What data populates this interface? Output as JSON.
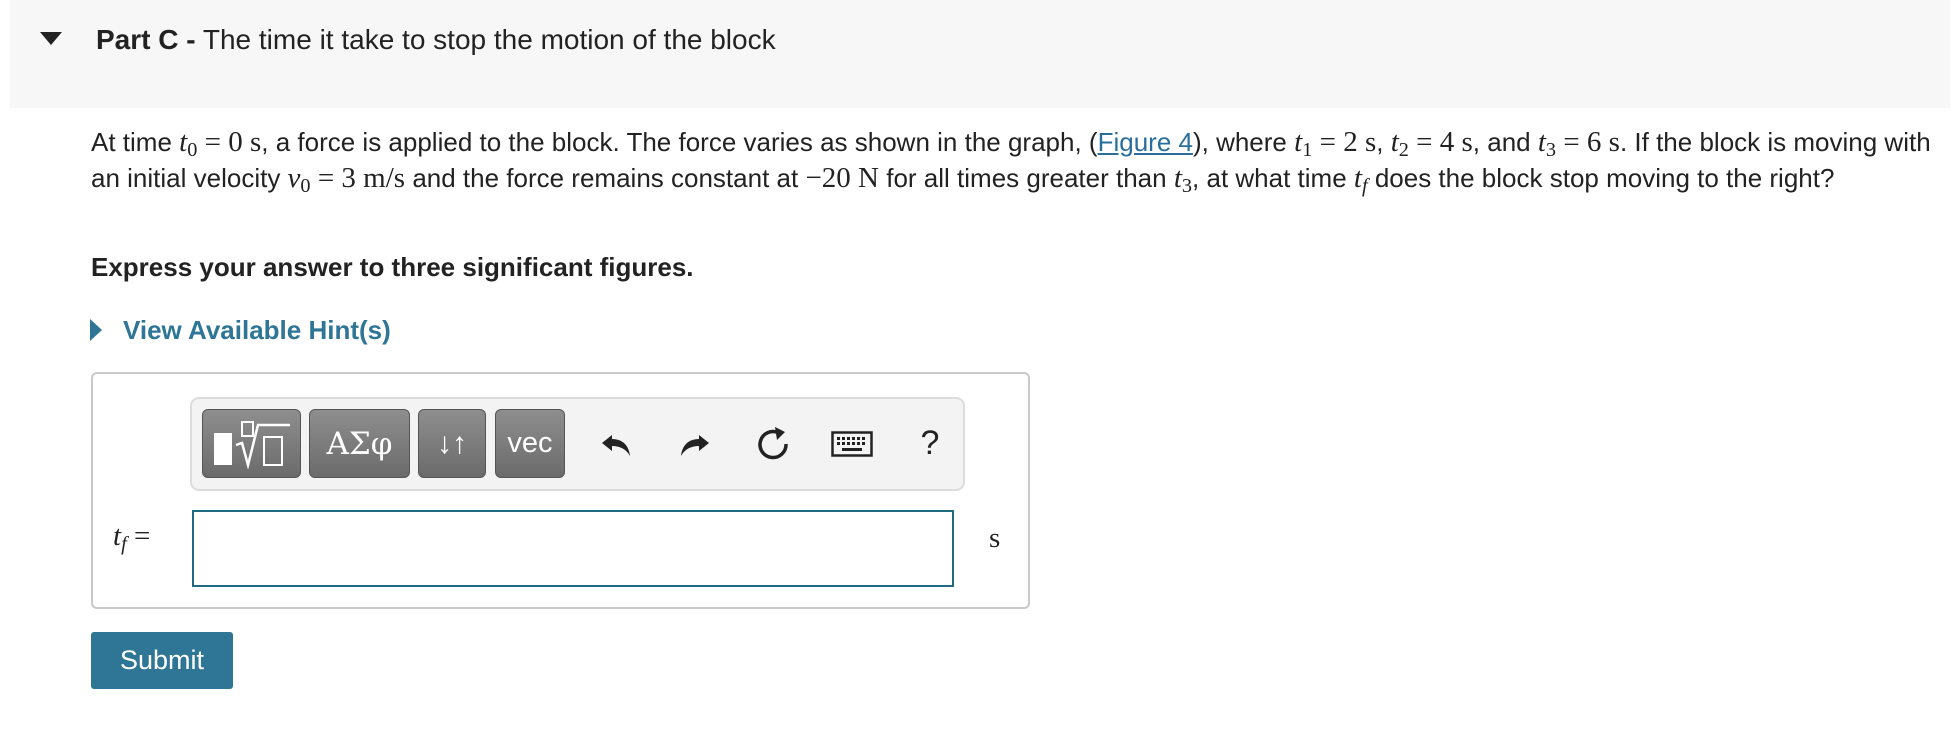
{
  "part": {
    "label": "Part C -",
    "title": "The time it take to stop the motion of the block"
  },
  "question": {
    "t1": "At time",
    "t2": ", a force is applied to the block. The force varies as shown in the graph, (",
    "figure_link": "Figure 4",
    "t3": "), where",
    "t4": ", and",
    "t5": ". If the block is moving with an initial velocity",
    "t6": "and the force remains constant at",
    "t7": "for all times greater than",
    "t8": ", at what time",
    "t9": "does the block stop moving to the right?",
    "math": {
      "t0": "0 s",
      "t1": "2 s",
      "t2": "4 s",
      "t3": "6 s",
      "v0": "3 m/s",
      "force": "−20 N"
    }
  },
  "instruction": "Express your answer to three significant figures.",
  "hint_label": "View Available Hint(s)",
  "answer": {
    "variable": "t",
    "variable_sub": "f",
    "equals": "=",
    "unit": "s",
    "value": ""
  },
  "toolbar": {
    "greek_label": "ΑΣφ",
    "arrows_label": "↓↑",
    "vec_label": "vec",
    "help_label": "?",
    "icons": [
      "templates-icon",
      "undo-icon",
      "redo-icon",
      "reset-icon",
      "keyboard-icon"
    ]
  },
  "submit_label": "Submit",
  "colors": {
    "header_bg": "#f7f7f7",
    "link": "#2a6f9b",
    "accent": "#2f7596",
    "input_border": "#1e6a80",
    "toolbar_button": "#7a7a7a"
  }
}
